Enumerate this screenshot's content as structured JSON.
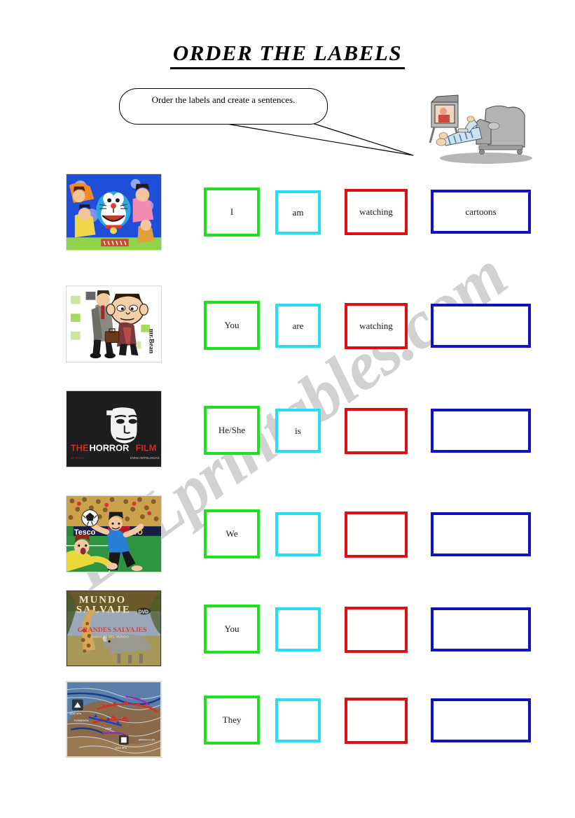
{
  "page": {
    "title": "ORDER THE LABELS",
    "watermark": "ESLprintables.com",
    "background_color": "#ffffff"
  },
  "instruction": {
    "bubble_text": "Order the labels and create a sentences.",
    "speaker_icon": "tv-watching-person-icon"
  },
  "colors": {
    "subject_box": "#1ee01e",
    "verb_box": "#22dff5",
    "action_box": "#e00e0e",
    "object_box": "#1111c4",
    "title_text": "#000000",
    "watermark_text": "#8c8c8c"
  },
  "columns": [
    {
      "key": "subject",
      "color": "#1ee01e"
    },
    {
      "key": "verb",
      "color": "#22dff5"
    },
    {
      "key": "action",
      "color": "#e00e0e"
    },
    {
      "key": "object",
      "color": "#1111c4"
    }
  ],
  "rows": [
    {
      "image_name": "doraemon-cartoon-poster",
      "image_caption": "DORAEMON",
      "subject": "I",
      "verb": "am",
      "action": "watching",
      "object": "cartoons"
    },
    {
      "image_name": "mr-bean-poster",
      "image_caption": "mr.Bean",
      "subject": "You",
      "verb": "are",
      "action": "watching",
      "object": ""
    },
    {
      "image_name": "the-horror-film-poster",
      "image_caption": "THE HORROR FILM",
      "subject": "He/She",
      "verb": "is",
      "action": "",
      "object": ""
    },
    {
      "image_name": "football-match-cartoon",
      "image_caption": "Tesco",
      "subject": "We",
      "verb": "",
      "action": "",
      "object": ""
    },
    {
      "image_name": "mundo-salvaje-dvd-cover",
      "image_caption": "MUNDO SALVAJE",
      "subject": "You",
      "verb": "",
      "action": "",
      "object": ""
    },
    {
      "image_name": "weather-map-chart",
      "image_caption": "",
      "subject": "They",
      "verb": "",
      "action": "",
      "object": ""
    }
  ]
}
